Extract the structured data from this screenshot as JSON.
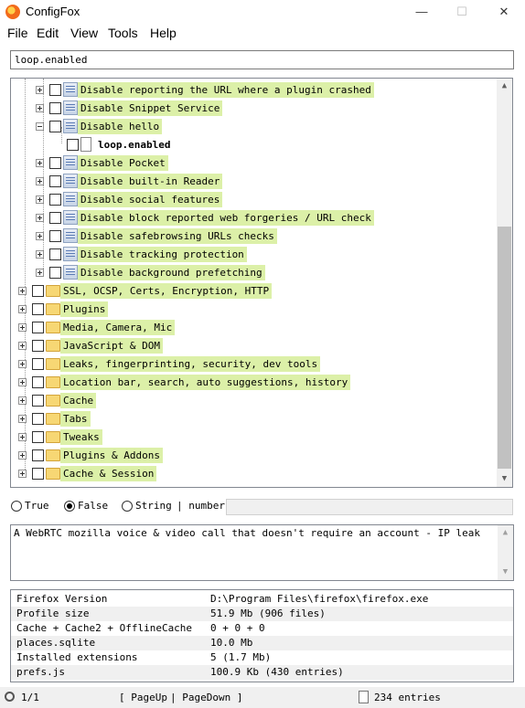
{
  "window": {
    "title": "ConfigFox",
    "minimize": "—",
    "maximize": "☐",
    "close": "✕"
  },
  "menu": {
    "file": "File",
    "edit": "Edit",
    "view": "View",
    "tools": "Tools",
    "help": "Help"
  },
  "search": {
    "value": "loop.enabled"
  },
  "tree": {
    "children": [
      {
        "label": "Disable reporting the URL where a plugin crashed",
        "expander": "plus"
      },
      {
        "label": "Disable Snippet Service",
        "expander": "plus"
      },
      {
        "label": "Disable hello",
        "expander": "minus"
      },
      {
        "label": "loop.enabled"
      },
      {
        "label": "Disable Pocket",
        "expander": "plus"
      },
      {
        "label": "Disable built-in Reader",
        "expander": "plus"
      },
      {
        "label": "Disable social features",
        "expander": "plus"
      },
      {
        "label": "Disable block reported web forgeries / URL check",
        "expander": "plus"
      },
      {
        "label": "Disable safebrowsing URLs checks",
        "expander": "plus"
      },
      {
        "label": "Disable tracking protection",
        "expander": "plus"
      },
      {
        "label": "Disable background prefetching",
        "expander": "plus"
      }
    ],
    "categories": [
      {
        "label": "SSL, OCSP, Certs, Encryption, HTTP"
      },
      {
        "label": "Plugins"
      },
      {
        "label": "Media, Camera, Mic"
      },
      {
        "label": "JavaScript & DOM"
      },
      {
        "label": "Leaks, fingerprinting, security, dev tools"
      },
      {
        "label": "Location bar, search, auto suggestions, history"
      },
      {
        "label": "Cache"
      },
      {
        "label": "Tabs"
      },
      {
        "label": "Tweaks"
      },
      {
        "label": "Plugins & Addons"
      },
      {
        "label": "Cache & Session"
      }
    ]
  },
  "value_type": {
    "true_label": "True",
    "false_label": "False",
    "string_label": "String",
    "number_label": "| number:",
    "selected": "False"
  },
  "description": "A WebRTC mozilla voice & video call that doesn't require an account - IP leak",
  "info": [
    {
      "key": "Firefox Version",
      "value": "D:\\Program Files\\firefox\\firefox.exe"
    },
    {
      "key": "Profile size",
      "value": "51.9 Mb (906 files)"
    },
    {
      "key": "Cache + Cache2 + OfflineCache",
      "value": "0 + 0 + 0"
    },
    {
      "key": "places.sqlite",
      "value": "10.0 Mb"
    },
    {
      "key": "Installed extensions",
      "value": "5 (1.7 Mb)"
    },
    {
      "key": "prefs.js",
      "value": "100.9 Kb (430 entries)"
    }
  ],
  "status": {
    "page": "1/1",
    "page_up": "[ PageUp",
    "page_down": "| PageDown ]",
    "entries": "234 entries"
  }
}
